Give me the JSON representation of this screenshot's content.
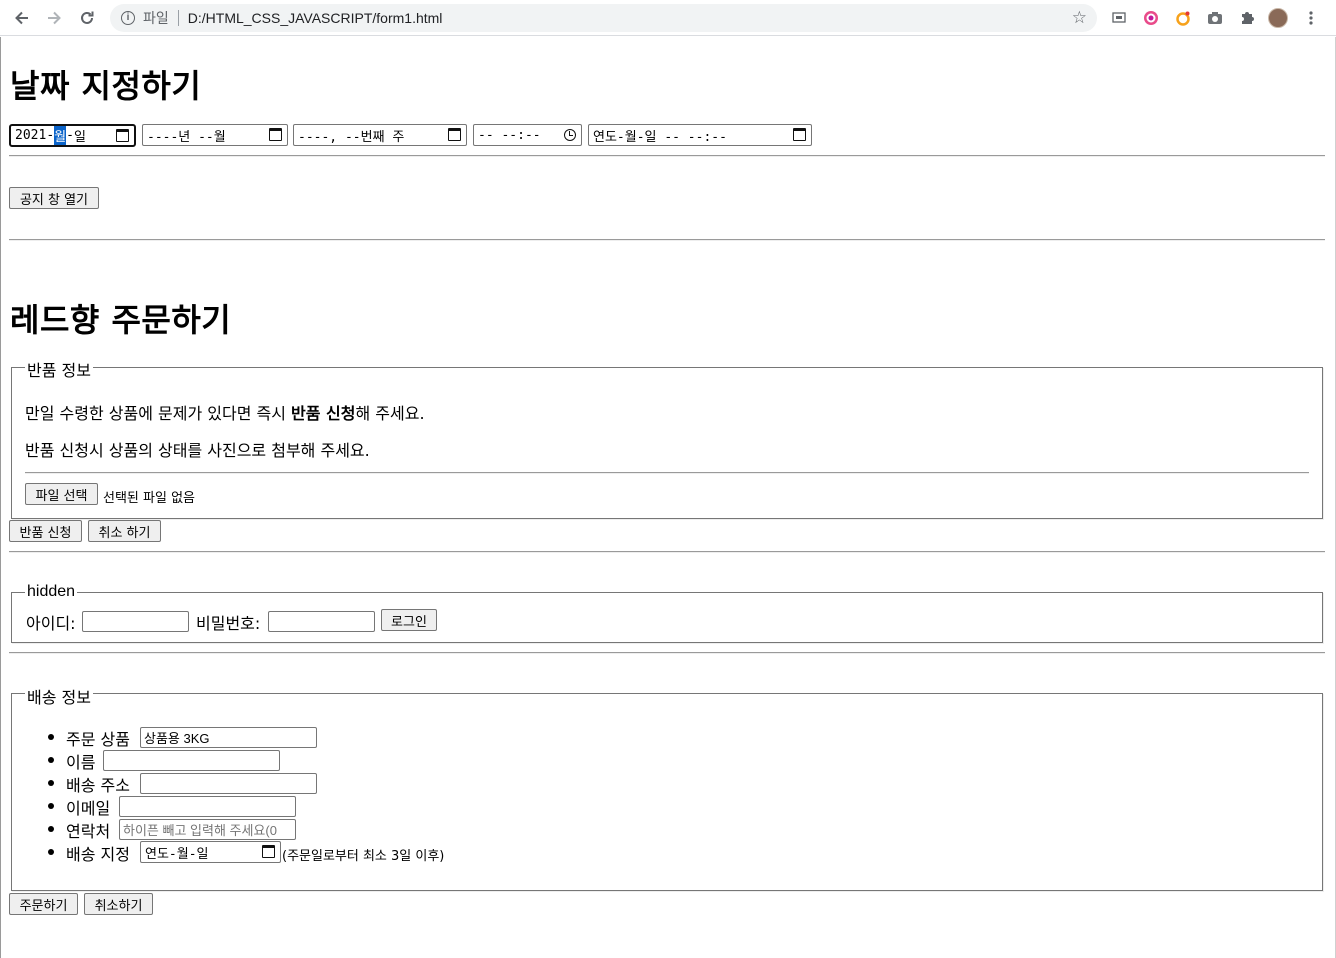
{
  "browser": {
    "scheme_label": "파일",
    "url": "D:/HTML_CSS_JAVASCRIPT/form1.html"
  },
  "date_section": {
    "title": "날짜 지정하기",
    "date_input": {
      "year": "2021",
      "sep1": "-",
      "month": "월",
      "sep2": "-",
      "day": "일"
    },
    "month_input": "----년 --월",
    "week_input": "----, --번째 주",
    "time_input": "-- --:--",
    "datetime_input": "연도-월-일 -- --:--",
    "notice_button": "공지 창 열기"
  },
  "order_section": {
    "title": "레드향 주문하기",
    "return_fieldset": {
      "legend": "반품 정보",
      "line1_before": "만일 수령한 상품에 문제가 있다면 즉시 ",
      "line1_bold": "반품 신청",
      "line1_after": "해 주세요.",
      "line2": "반품 신청시 상품의 상태를 사진으로 첨부해 주세요.",
      "file_button": "파일 선택",
      "file_status": "선택된 파일 없음"
    },
    "return_button": "반품 신청",
    "cancel_button": "취소 하기",
    "login_fieldset": {
      "legend": "hidden",
      "id_label": "아이디:",
      "id_value": "",
      "pw_label": "비밀번호:",
      "pw_value": "",
      "login_button": "로그인"
    },
    "shipping_fieldset": {
      "legend": "배송 정보",
      "items": [
        {
          "label": "주문 상품",
          "value": "상품용 3KG",
          "placeholder": ""
        },
        {
          "label": "이름",
          "value": "",
          "placeholder": ""
        },
        {
          "label": "배송 주소",
          "value": "",
          "placeholder": ""
        },
        {
          "label": "이메일",
          "value": "",
          "placeholder": ""
        },
        {
          "label": "연락처",
          "value": "",
          "placeholder": "하이픈 빼고 입력해 주세요(0"
        },
        {
          "label": "배송 지정",
          "value": "연도-월-일",
          "placeholder": ""
        }
      ],
      "delivery_note": "(주문일로부터 최소 3일 이후)"
    },
    "order_button": "주문하기",
    "cancel_order_button": "취소하기"
  },
  "colors": {
    "accent_highlight": "#0a63c9",
    "button_bg": "#efefef"
  }
}
